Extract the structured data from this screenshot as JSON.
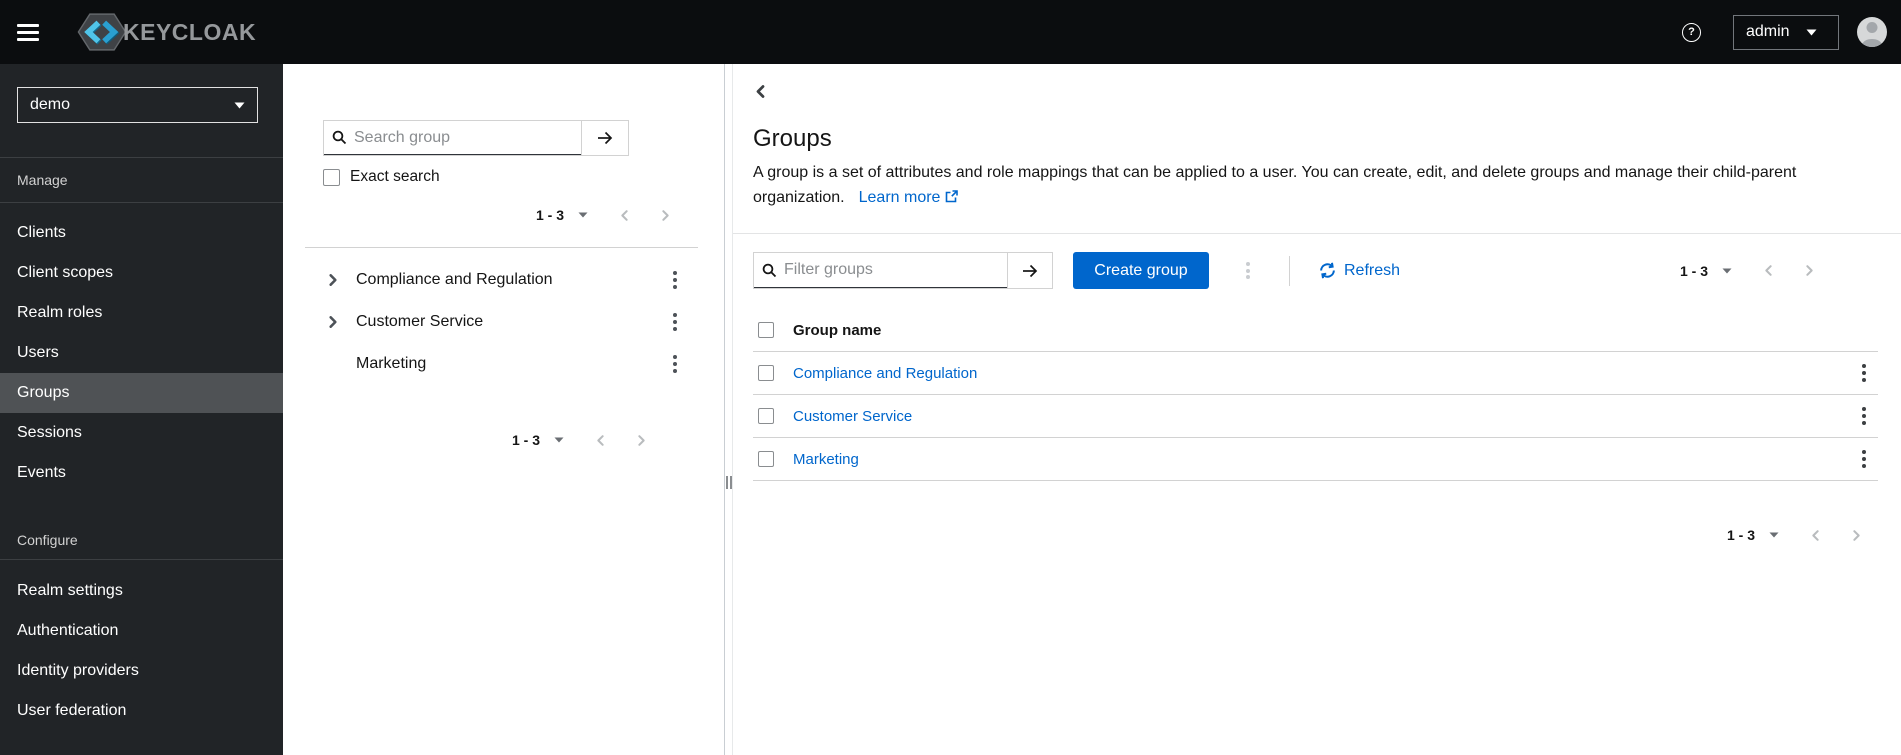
{
  "masthead": {
    "brand": "KEYCLOAK",
    "user_menu": "admin"
  },
  "sidebar": {
    "realm": "demo",
    "sections": [
      {
        "title": "Manage",
        "items": [
          {
            "label": "Clients",
            "active": false
          },
          {
            "label": "Client scopes",
            "active": false
          },
          {
            "label": "Realm roles",
            "active": false
          },
          {
            "label": "Users",
            "active": false
          },
          {
            "label": "Groups",
            "active": true
          },
          {
            "label": "Sessions",
            "active": false
          },
          {
            "label": "Events",
            "active": false
          }
        ]
      },
      {
        "title": "Configure",
        "items": [
          {
            "label": "Realm settings",
            "active": false
          },
          {
            "label": "Authentication",
            "active": false
          },
          {
            "label": "Identity providers",
            "active": false
          },
          {
            "label": "User federation",
            "active": false
          }
        ]
      }
    ]
  },
  "tree_panel": {
    "search_placeholder": "Search group",
    "exact_search_label": "Exact search",
    "pagination_range": "1 - 3",
    "items": [
      {
        "label": "Compliance and Regulation",
        "expandable": true
      },
      {
        "label": "Customer Service",
        "expandable": true
      },
      {
        "label": "Marketing",
        "expandable": false
      }
    ]
  },
  "main": {
    "title": "Groups",
    "description": "A group is a set of attributes and role mappings that can be applied to a user. You can create, edit, and delete groups and manage their child-parent organization.",
    "learn_more_label": "Learn more",
    "toolbar": {
      "filter_placeholder": "Filter groups",
      "create_label": "Create group",
      "refresh_label": "Refresh",
      "pagination_range": "1 - 3"
    },
    "table": {
      "column_header": "Group name",
      "rows": [
        {
          "name": "Compliance and Regulation"
        },
        {
          "name": "Customer Service"
        },
        {
          "name": "Marketing"
        }
      ]
    },
    "bottom_pagination_range": "1 - 3"
  },
  "colors": {
    "accent": "#0066cc",
    "link": "#0066cc",
    "masthead_bg": "#0b0d0f",
    "sidebar_bg": "#212427",
    "sidebar_active_bg": "#4f5255",
    "border": "#d2d2d2",
    "text": "#151515",
    "muted": "#6a6e73"
  }
}
